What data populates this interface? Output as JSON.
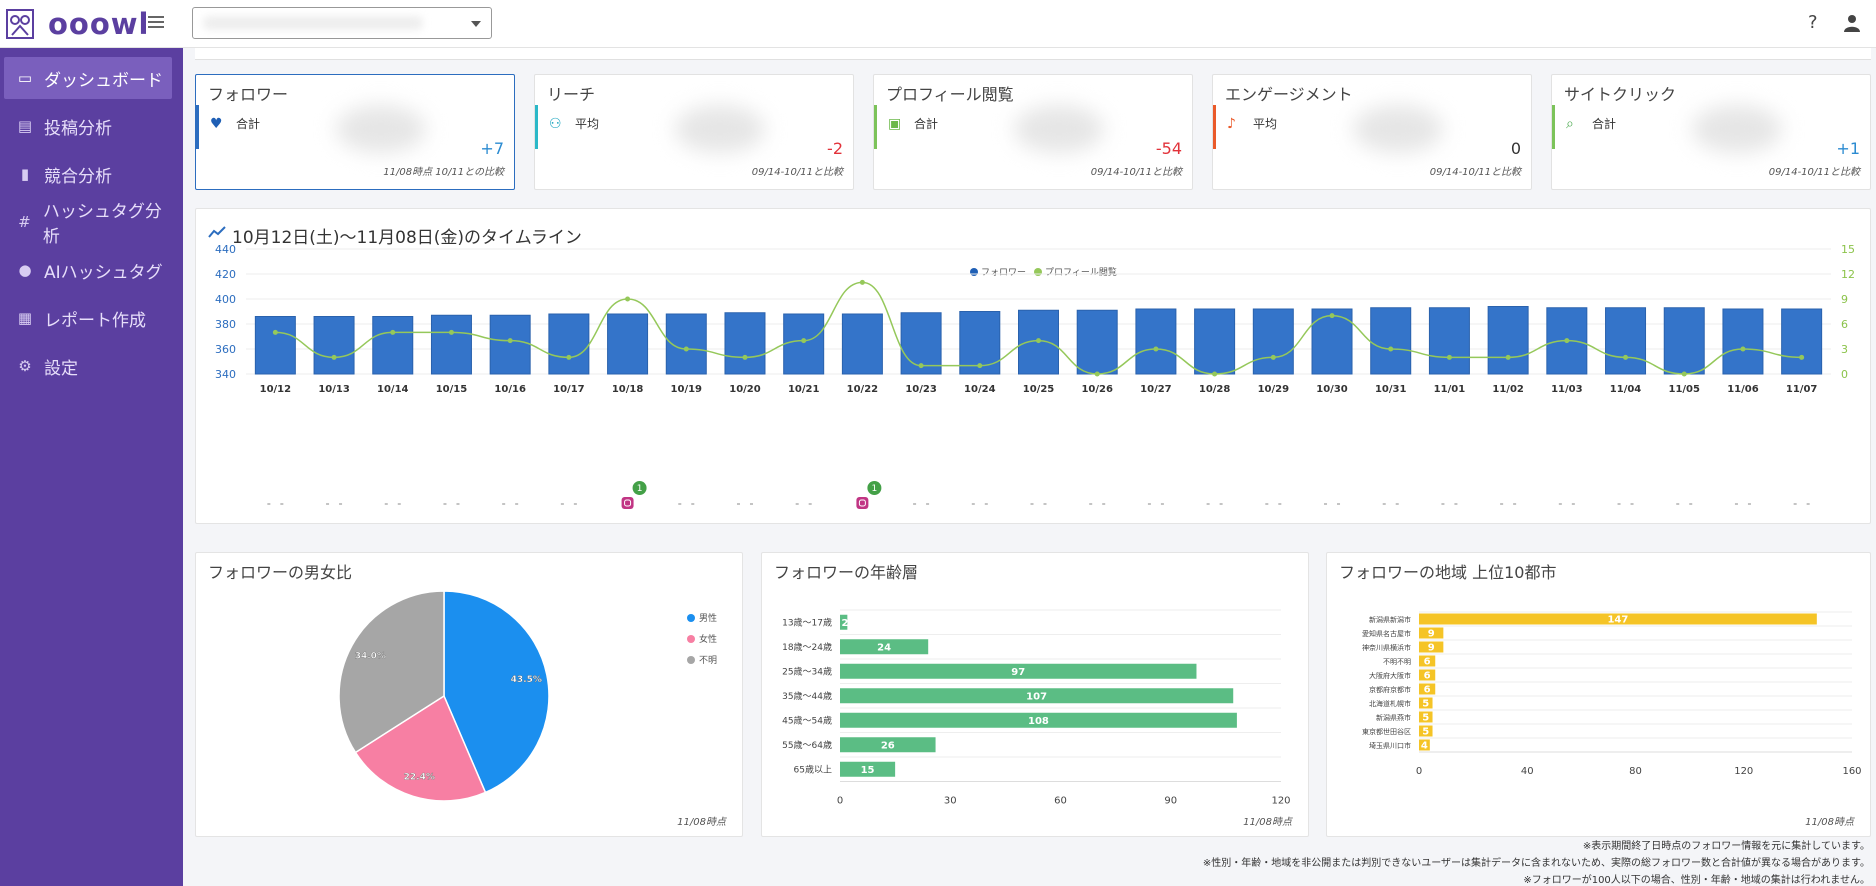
{
  "app": {
    "name": "ooowl"
  },
  "colors": {
    "sidebar": "#5b3fa0",
    "bar": "#3474c9",
    "line": "#95c85a",
    "male": "#1b8fef",
    "female": "#f77fa3",
    "unknown": "#a6a6a6",
    "age": "#5bbd84",
    "region": "#f5c426",
    "positive": "#2b8bd1",
    "negative": "#e2323a"
  },
  "topbar": {
    "help_icon": "?",
    "account_select": ""
  },
  "sidebar": {
    "items": [
      {
        "label": "ダッシュボード",
        "icon": "monitor-icon"
      },
      {
        "label": "投稿分析",
        "icon": "document-icon"
      },
      {
        "label": "競合分析",
        "icon": "bar-chart-icon"
      },
      {
        "label": "ハッシュタグ分析",
        "icon": "hashtag-icon"
      },
      {
        "label": "AIハッシュタグ",
        "icon": "bulb-icon"
      },
      {
        "label": "レポート作成",
        "icon": "report-icon"
      },
      {
        "label": "設定",
        "icon": "gear-icon"
      }
    ]
  },
  "kpis": [
    {
      "title": "フォロワー",
      "sub": "合計",
      "delta": "+7",
      "note": "11/08時点 10/11との比較",
      "icon": "heart-icon"
    },
    {
      "title": "リーチ",
      "sub": "平均",
      "delta": "-2",
      "note": "09/14-10/11と比較",
      "icon": "people-icon"
    },
    {
      "title": "プロフィール閲覧",
      "sub": "合計",
      "delta": "-54",
      "note": "09/14-10/11と比較",
      "icon": "id-card-icon"
    },
    {
      "title": "エンゲージメント",
      "sub": "平均",
      "delta": "0",
      "note": "09/14-10/11と比較",
      "icon": "bell-icon"
    },
    {
      "title": "サイトクリック",
      "sub": "合計",
      "delta": "+1",
      "note": "09/14-10/11と比較",
      "icon": "search-click-icon"
    }
  ],
  "timeline": {
    "title": "10月12日(土)～11月08日(金)のタイムライン"
  },
  "chart_data": [
    {
      "type": "bar",
      "categories": [
        "10/12",
        "10/13",
        "10/14",
        "10/15",
        "10/16",
        "10/17",
        "10/18",
        "10/19",
        "10/20",
        "10/21",
        "10/22",
        "10/23",
        "10/24",
        "10/25",
        "10/26",
        "10/27",
        "10/28",
        "10/29",
        "10/30",
        "10/31",
        "11/01",
        "11/02",
        "11/03",
        "11/04",
        "11/05",
        "11/06",
        "11/07"
      ],
      "series": [
        {
          "name": "フォロワー",
          "axis": "left",
          "values": [
            386,
            386,
            386,
            387,
            387,
            388,
            388,
            388,
            389,
            388,
            388,
            389,
            390,
            391,
            391,
            392,
            392,
            392,
            392,
            393,
            393,
            394,
            393,
            393,
            393,
            392,
            392
          ]
        },
        {
          "name": "プロフィール閲覧",
          "axis": "right",
          "type": "line",
          "values": [
            5,
            2,
            5,
            5,
            4,
            2,
            9,
            3,
            2,
            4,
            11,
            1,
            1,
            4,
            0,
            3,
            0,
            2,
            7,
            3,
            2,
            2,
            4,
            2,
            0,
            3,
            2
          ]
        }
      ],
      "ylim": [
        340,
        440
      ],
      "y_ticks": [
        340,
        360,
        380,
        400,
        420,
        440
      ],
      "y2lim": [
        0,
        15
      ],
      "y2_ticks": [
        0,
        3,
        6,
        9,
        12,
        15
      ],
      "post_markers": [
        {
          "date": "10/18",
          "count": "1"
        },
        {
          "date": "10/22",
          "count": "1"
        }
      ],
      "legend": "top-center"
    },
    {
      "type": "pie",
      "title": "フォロワーの男女比",
      "labels": [
        "男性",
        "女性",
        "不明"
      ],
      "values": [
        43.5,
        22.4,
        34.0
      ],
      "value_labels": [
        "43.5%",
        "22.4%",
        "34.0%"
      ],
      "legend": "right",
      "footnote": "11/08時点"
    },
    {
      "type": "bar",
      "orientation": "horizontal",
      "title": "フォロワーの年齢層",
      "categories": [
        "13歳～17歳",
        "18歳～24歳",
        "25歳～34歳",
        "35歳～44歳",
        "45歳～54歳",
        "55歳～64歳",
        "65歳以上"
      ],
      "values": [
        2,
        24,
        97,
        107,
        108,
        26,
        15
      ],
      "xlim": [
        0,
        120
      ],
      "x_ticks": [
        0,
        30,
        60,
        90,
        120
      ],
      "footnote": "11/08時点"
    },
    {
      "type": "bar",
      "orientation": "horizontal",
      "title": "フォロワーの地域 上位10都市",
      "categories": [
        "新潟県新潟市",
        "愛知県名古屋市",
        "神奈川県横浜市",
        "不明不明",
        "大阪府大阪市",
        "京都府京都市",
        "北海道札幌市",
        "新潟県燕市",
        "東京都世田谷区",
        "埼玉県川口市"
      ],
      "values": [
        147,
        9,
        9,
        6,
        6,
        6,
        5,
        5,
        5,
        4
      ],
      "xlim": [
        0,
        160
      ],
      "x_ticks": [
        0,
        40,
        80,
        120,
        160
      ],
      "footnote": "11/08時点"
    }
  ],
  "notes": [
    "※表示期間終了日時点のフォロワー情報を元に集計しています。",
    "※性別・年齢・地域を非公開または判別できないユーザーは集計データに含まれないため、実際の総フォロワー数と合計値が異なる場合があります。",
    "※フォロワーが100人以下の場合、性別・年齢・地域の集計は行われません。"
  ]
}
